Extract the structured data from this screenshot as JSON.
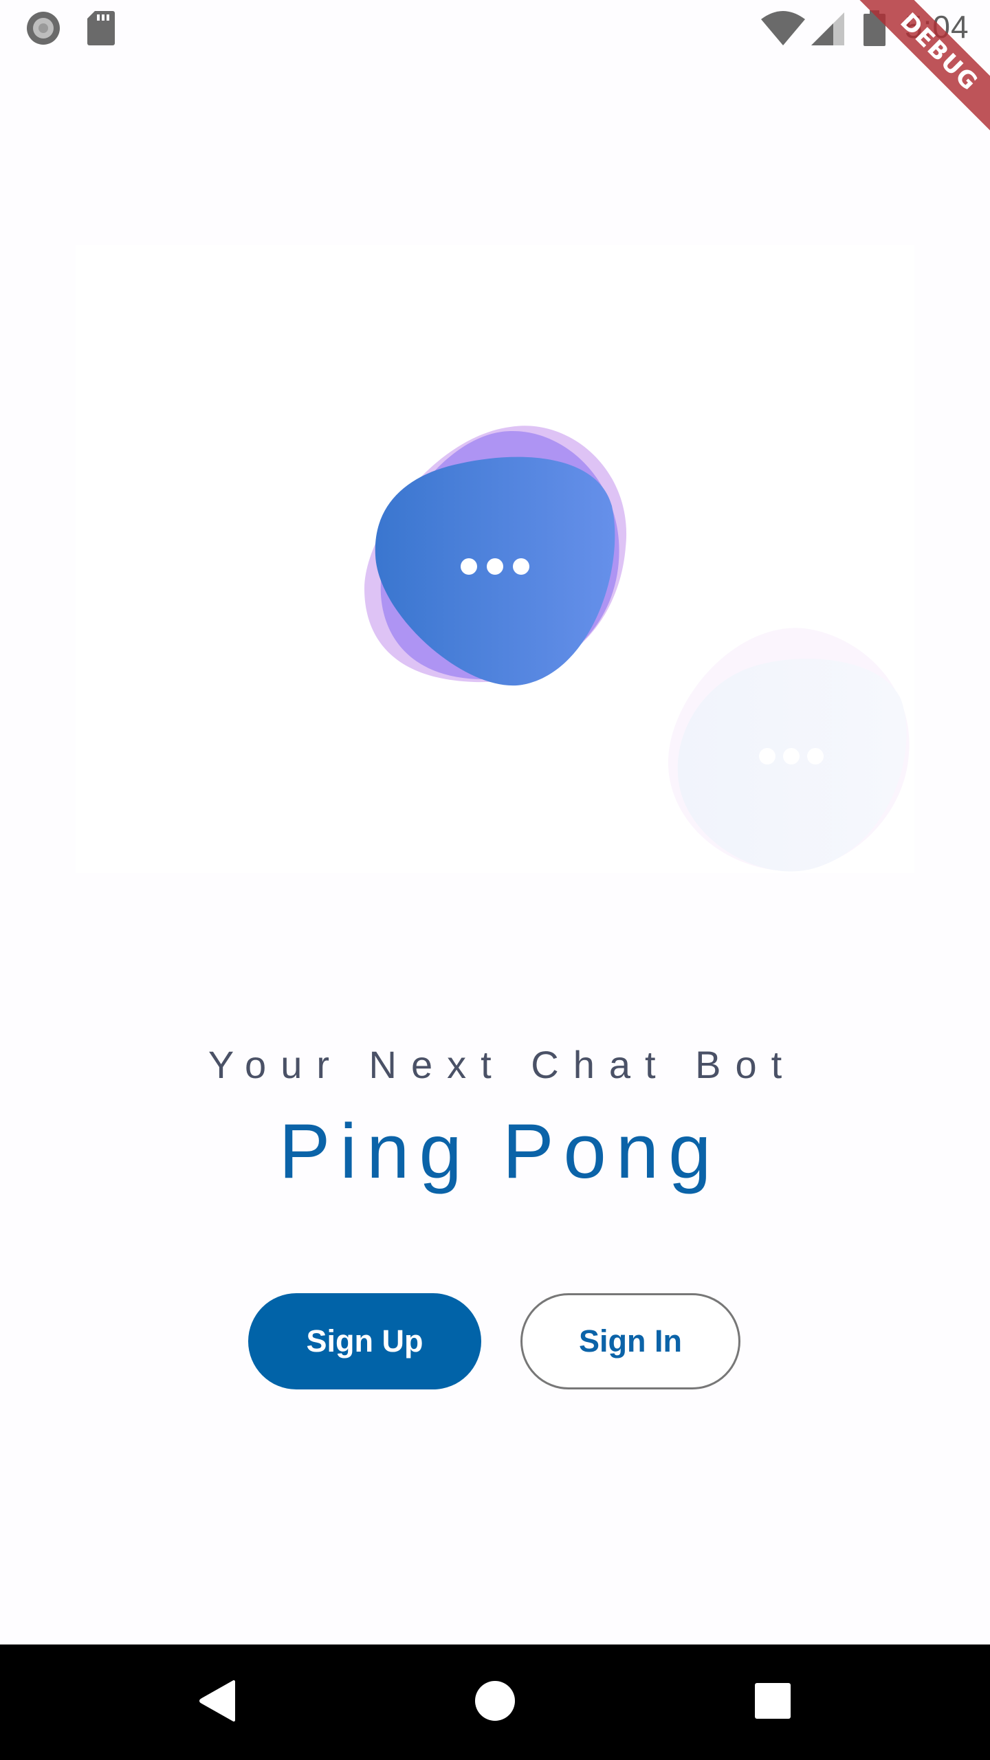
{
  "status_bar": {
    "time": "5:04",
    "left_icons": [
      "recording-icon",
      "sd-card-icon"
    ],
    "right_icons": [
      "wifi-icon",
      "cellular-signal-icon",
      "battery-icon"
    ]
  },
  "debug_banner": {
    "label": "DEBUG",
    "color": "#b02e34"
  },
  "illustration": {
    "primary_bubble_icon": "ellipsis-icon",
    "secondary_bubble_icon": "ellipsis-icon",
    "colors": {
      "bubble_blue_start": "#3a76cf",
      "bubble_blue_end": "#6690ea",
      "bubble_purple": "#a68cf2",
      "bubble_lilac": "#d8b8f3"
    }
  },
  "intro": {
    "tagline": "Your Next Chat Bot",
    "title": "Ping Pong"
  },
  "actions": {
    "sign_up_label": "Sign Up",
    "sign_in_label": "Sign In"
  },
  "colors": {
    "brand_blue": "#0163a8",
    "tagline_gray": "#4a5166",
    "background": "#fefdff"
  },
  "nav_bar": {
    "buttons": [
      "back-icon",
      "home-icon",
      "recents-icon"
    ]
  }
}
